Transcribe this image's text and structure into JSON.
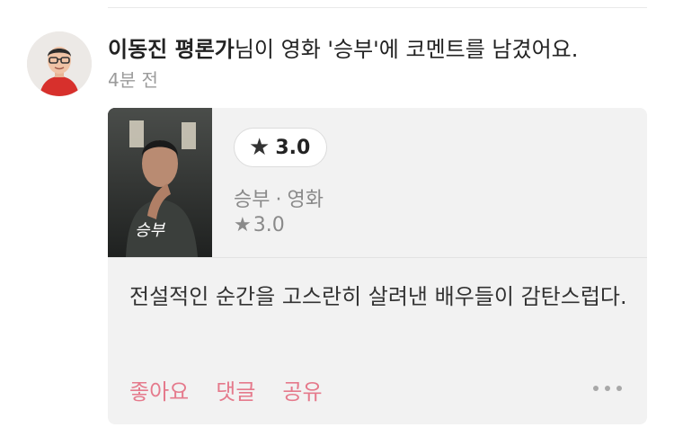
{
  "activity": {
    "user_name": "이동진 평론가",
    "message": "님이 영화 '승부'에 코멘트를 남겼어요.",
    "time_ago": "4분 전"
  },
  "card": {
    "poster_title": "승부",
    "user_rating": "3.0",
    "movie_title": "승부",
    "separator": "·",
    "category": "영화",
    "avg_rating": "3.0",
    "comment": "전설적인 순간을 고스란히 살려낸 배우들이 감탄스럽다."
  },
  "actions": {
    "like": "좋아요",
    "comment": "댓글",
    "share": "공유"
  },
  "colors": {
    "accent": "#e57a8c",
    "card_bg": "#f2f2f2",
    "muted_text": "#8a8a8a"
  },
  "icons": {
    "rating_star": "★",
    "more": "more-horizontal-icon"
  }
}
